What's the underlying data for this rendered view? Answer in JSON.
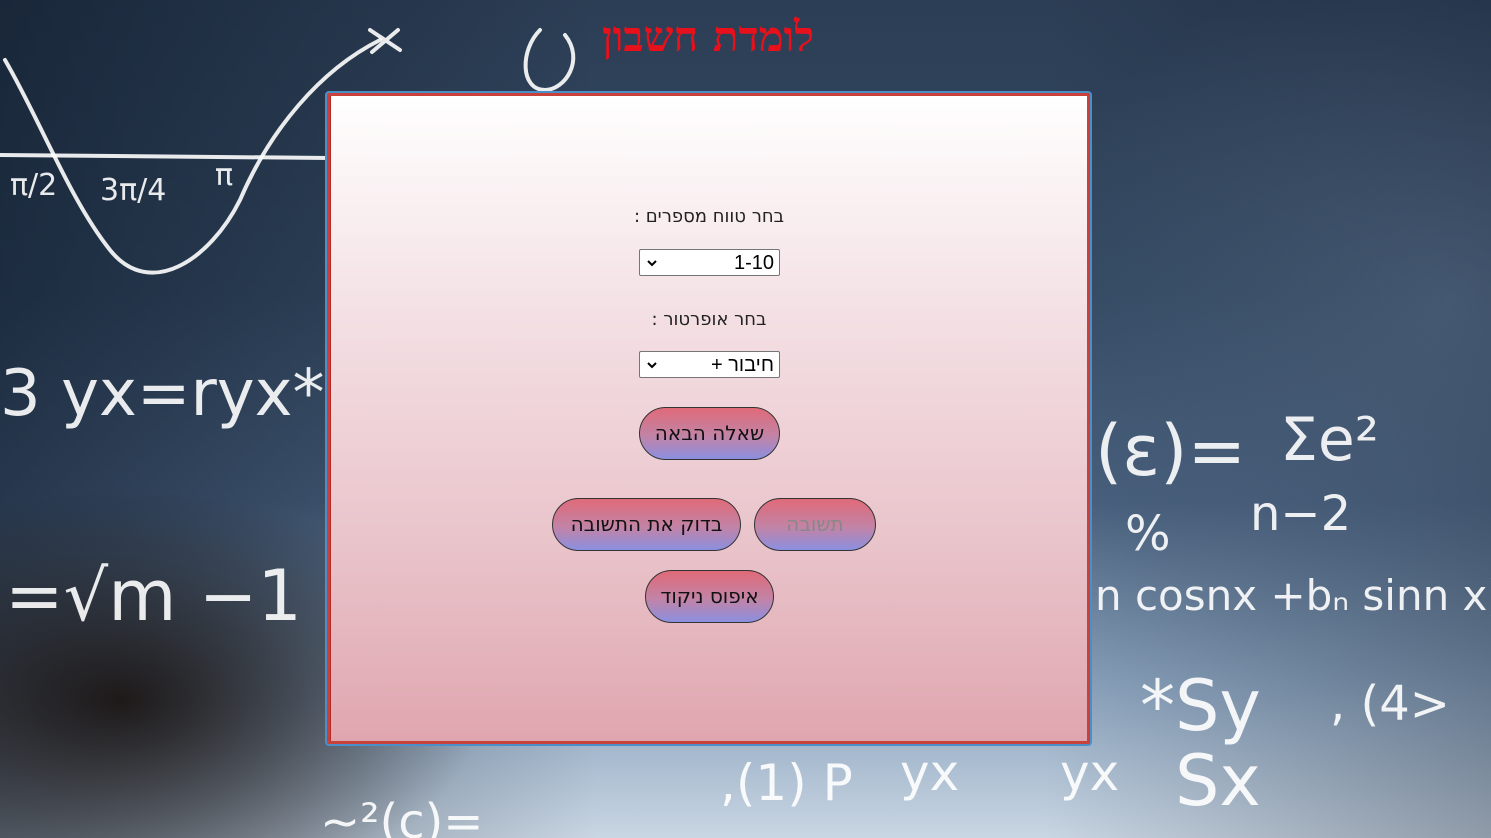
{
  "app": {
    "title": "לומדת חשבון"
  },
  "controls": {
    "range_label": "בחר טווח מספרים :",
    "range_selected": "1-10",
    "operator_label": "בחר אופרטור :",
    "operator_selected": "חיבור +"
  },
  "buttons": {
    "next_question": "שאלה הבאה",
    "answer": "תשובה",
    "check_answer": "בדוק את התשובה",
    "reset_score": "איפוס ניקוד"
  },
  "colors": {
    "title": "#e8101a",
    "panel_border": "#c8413a",
    "panel_outline": "#4a8fc7",
    "button_top": "#e06a78",
    "button_bottom": "#8b8fe0"
  },
  "icons": {
    "select_arrow": "chevron-down-icon"
  }
}
